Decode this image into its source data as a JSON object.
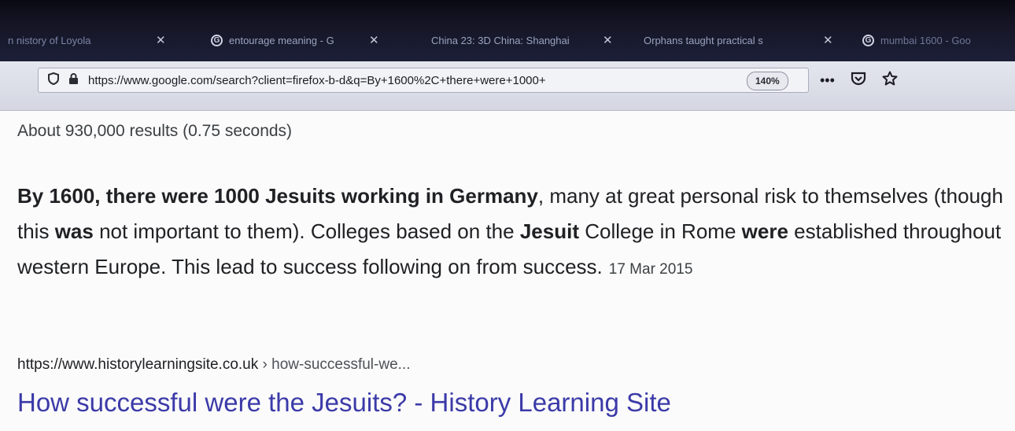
{
  "tabs": [
    {
      "title": "n nistory of Loyola",
      "favicon": "",
      "close": "✕"
    },
    {
      "title": "entourage meaning - G",
      "favicon": "google-icon",
      "close": "✕"
    },
    {
      "title": "China 23: 3D China: Shanghai",
      "favicon": "",
      "close": "✕"
    },
    {
      "title": "Orphans taught practical s",
      "favicon": "",
      "close": "✕"
    },
    {
      "title": "mumbai 1600 - Goo",
      "favicon": "google-icon",
      "close": ""
    }
  ],
  "navbar": {
    "url": "https://www.google.com/search?client=firefox-b-d&q=By+1600%2C+there+were+1000+",
    "zoom": "140%",
    "more": "•••"
  },
  "results": {
    "stats": "About 930,000 results (0.75 seconds)",
    "snippet_parts": {
      "p1": "By 1600, there were 1000 Jesuits working in Germany",
      "p2": ", many at great personal risk to themselves (though this ",
      "p3": "was",
      "p4": " not important to them). Colleges based on the ",
      "p5": "Jesuit",
      "p6": " College in Rome ",
      "p7": "were",
      "p8": " established throughout western Europe. This lead to success following on from success.",
      "date": "17 Mar 2015"
    },
    "cite_domain": "https://www.historylearningsite.co.uk",
    "cite_path": " › how-successful-we...",
    "title": "How successful were the Jesuits? - History Learning Site",
    "link_color": "#3b3aa8"
  }
}
